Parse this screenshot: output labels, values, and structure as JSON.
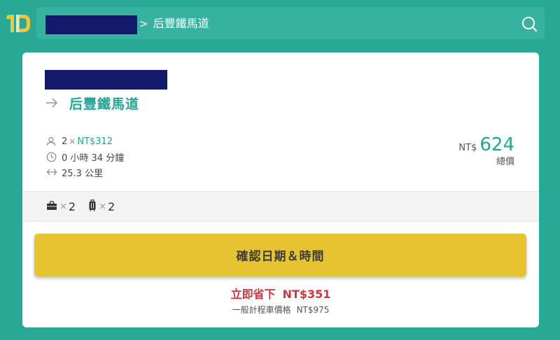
{
  "header": {
    "breadcrumb_separator": ">",
    "destination": "后豐鐵馬道",
    "search_icon": "search-icon",
    "logo_icon": "app-logo"
  },
  "trip": {
    "arrow_icon": "arrow-right-icon",
    "destination": "后豐鐵馬道",
    "passengers": {
      "icon": "person-icon",
      "count": "2",
      "multiplier": "×",
      "price": "NT$312"
    },
    "duration": {
      "icon": "clock-icon",
      "text": "0 小時 34 分鐘"
    },
    "distance": {
      "icon": "distance-arrows-icon",
      "text": "25.3 公里"
    }
  },
  "total": {
    "currency": "NT$",
    "amount": "624",
    "label": "總價"
  },
  "luggage": {
    "briefcase": {
      "icon": "briefcase-icon",
      "multiplier": "×",
      "count": "2"
    },
    "suitcase": {
      "icon": "suitcase-icon",
      "multiplier": "×",
      "count": "2"
    }
  },
  "cta": {
    "confirm_label": "確認日期＆時間"
  },
  "savings": {
    "label": "立即省下",
    "amount": "NT$351",
    "compare_label": "一般計程車價格",
    "compare_amount": "NT$975"
  },
  "colors": {
    "background": "#2aa896",
    "accent": "#23a592",
    "cta": "#e8c331",
    "savings": "#d2343f",
    "redaction": "#131a6b"
  }
}
